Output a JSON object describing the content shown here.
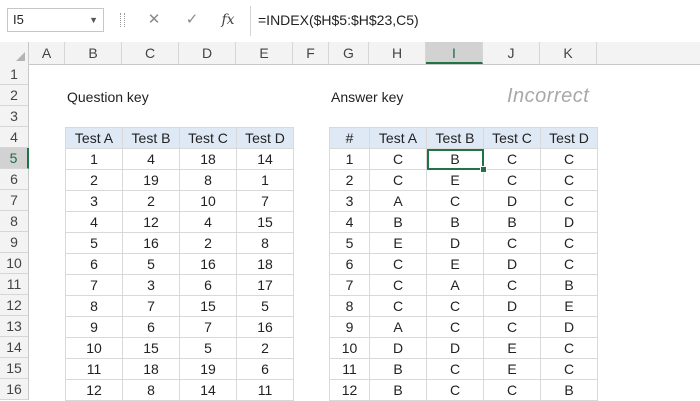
{
  "formula_bar": {
    "name_box": "I5",
    "cancel_icon": "✕",
    "enter_icon": "✓",
    "fx_label": "fx",
    "formula": "=INDEX($H$5:$H$23,C5)"
  },
  "columns": [
    "A",
    "B",
    "C",
    "D",
    "E",
    "F",
    "G",
    "H",
    "I",
    "J",
    "K"
  ],
  "rows": [
    "1",
    "2",
    "3",
    "4",
    "5",
    "6",
    "7",
    "8",
    "9",
    "10",
    "11",
    "12",
    "13",
    "14",
    "15",
    "16"
  ],
  "active_cell": "I5",
  "question_key": {
    "title": "Question key",
    "headers": [
      "Test A",
      "Test B",
      "Test C",
      "Test D"
    ],
    "rows": [
      [
        "1",
        "4",
        "18",
        "14"
      ],
      [
        "2",
        "19",
        "8",
        "1"
      ],
      [
        "3",
        "2",
        "10",
        "7"
      ],
      [
        "4",
        "12",
        "4",
        "15"
      ],
      [
        "5",
        "16",
        "2",
        "8"
      ],
      [
        "6",
        "5",
        "16",
        "18"
      ],
      [
        "7",
        "3",
        "6",
        "17"
      ],
      [
        "8",
        "7",
        "15",
        "5"
      ],
      [
        "9",
        "6",
        "7",
        "16"
      ],
      [
        "10",
        "15",
        "5",
        "2"
      ],
      [
        "11",
        "18",
        "19",
        "6"
      ],
      [
        "12",
        "8",
        "14",
        "11"
      ]
    ]
  },
  "answer_key": {
    "title": "Answer key",
    "headers": [
      "#",
      "Test A",
      "Test B",
      "Test C",
      "Test D"
    ],
    "rows": [
      [
        "1",
        "C",
        "B",
        "C",
        "C"
      ],
      [
        "2",
        "C",
        "E",
        "C",
        "C"
      ],
      [
        "3",
        "A",
        "C",
        "D",
        "C"
      ],
      [
        "4",
        "B",
        "B",
        "B",
        "D"
      ],
      [
        "5",
        "E",
        "D",
        "C",
        "C"
      ],
      [
        "6",
        "C",
        "E",
        "D",
        "C"
      ],
      [
        "7",
        "C",
        "A",
        "C",
        "B"
      ],
      [
        "8",
        "C",
        "C",
        "D",
        "E"
      ],
      [
        "9",
        "A",
        "C",
        "C",
        "D"
      ],
      [
        "10",
        "D",
        "D",
        "E",
        "C"
      ],
      [
        "11",
        "B",
        "C",
        "E",
        "C"
      ],
      [
        "12",
        "B",
        "C",
        "C",
        "B"
      ]
    ]
  },
  "overlay_text": "Incorrect"
}
